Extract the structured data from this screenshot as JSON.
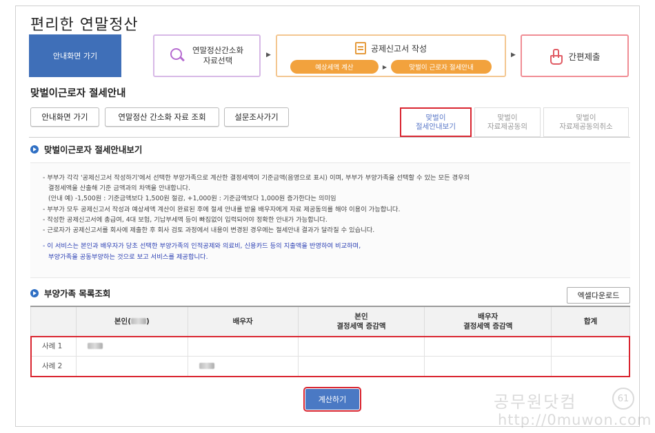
{
  "app": {
    "title": "편리한 연말정산"
  },
  "steps": {
    "home_label": "안내화면 가기",
    "step1_line1": "연말정산간소화",
    "step1_line2": "자료선택",
    "step2_title": "공제신고서 작성",
    "step2_pill1": "예상세액 계산",
    "step2_pill2": "맞벌이 근로자 절세안내",
    "step3_label": "간편제출",
    "arrow": "▶"
  },
  "page": {
    "subtitle": "맞벌이근로자 절세안내"
  },
  "buttons": {
    "home": "안내화면 가기",
    "simplified_lookup": "연말정산 간소화 자료 조회",
    "survey": "설문조사가기",
    "excel_download": "엑셀다운로드",
    "calculate": "계산하기"
  },
  "tabs": [
    {
      "line1": "맞벌이",
      "line2": "절세안내보기"
    },
    {
      "line1": "맞벌이",
      "line2": "자료제공동의"
    },
    {
      "line1": "맞벌이",
      "line2": "자료제공동의취소"
    }
  ],
  "section1": {
    "title": "맞벌이근로자 절세안내보기",
    "items": [
      "부부가 각각 '공제신고서 작성하기'에서 선택한 부양가족으로 계산한 결정세액이 기준금액(음영으로 표시) 이며, 부부가 부양가족을 선택할 수 있는 모든 경우의",
      "결정세액을 산출해 기준 금액과의 차액을 안내합니다.",
      "(안내 예) -1,500원 : 기준금액보다 1,500원 절감, +1,000원 : 기준금액보다 1,000원 증가한다는 의미임",
      "부부가 모두 공제신고서 작성과 예상세액 계산이 완료된 후에 절세 안내를 받을 배우자에게 자료 제공동의를 해야 이용이 가능합니다.",
      "작성한 공제신고서에 총급여, 4대 보험, 기납부세액 등이 빠짐없이 입력되어야 정확한 안내가 가능합니다.",
      "근로자가 공제신고서를 회사에 제출한 후 회사 검토 과정에서 내용이 변경된 경우에는 절세안내 결과가 달라질 수 있습니다."
    ],
    "note_line1": "이 서비스는 본인과 배우자가 당초 선택한 부양가족의 인적공제와 의료비, 신용카드 등의 지출액을 반영하여 비교하며,",
    "note_line2": "부양가족을 공동부양하는 것으로 보고 서비스를 제공합니다."
  },
  "section2": {
    "title": "부양가족 목록조회"
  },
  "table": {
    "headers": {
      "self": "본인(",
      "self_close": ")",
      "spouse": "배우자",
      "self_tax_l1": "본인",
      "self_tax_l2": "결정세액 증감액",
      "spouse_tax_l1": "배우자",
      "spouse_tax_l2": "결정세액 증감액",
      "total": "합계"
    },
    "rows": [
      {
        "label": "사례 1"
      },
      {
        "label": "사례 2"
      }
    ]
  },
  "watermark": {
    "line1": "공무원닷컴",
    "line2": "http://0muwon.com",
    "circle": "61"
  },
  "colors": {
    "accent_blue": "#3f6fb8",
    "highlight_red": "#d9242f",
    "pill_orange": "#f2a23d"
  }
}
